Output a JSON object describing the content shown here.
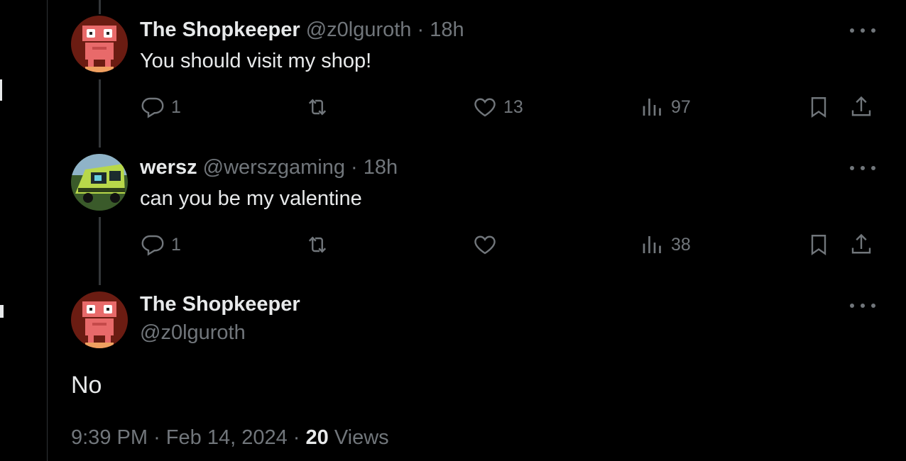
{
  "tweets": [
    {
      "name": "The Shopkeeper",
      "handle": "@z0lguroth",
      "time": "18h",
      "text": "You should visit my shop!",
      "replies": "1",
      "likes": "13",
      "views": "97"
    },
    {
      "name": "wersz",
      "handle": "@werszgaming",
      "time": "18h",
      "text": "can you be my valentine",
      "replies": "1",
      "views": "38"
    }
  ],
  "main": {
    "name": "The Shopkeeper",
    "handle": "@z0lguroth",
    "text": "No",
    "time": "9:39 PM",
    "date": "Feb 14, 2024",
    "views_count": "20",
    "views_label": "Views"
  },
  "separator": "·",
  "icons": {
    "reply": "reply-icon",
    "retweet": "retweet-icon",
    "like": "heart-icon",
    "views": "views-icon",
    "bookmark": "bookmark-icon",
    "share": "share-icon",
    "more": "more-icon"
  },
  "colors": {
    "background": "#000000",
    "text": "#e7e9ea",
    "muted": "#71767b",
    "thread_line": "#333639",
    "shopkeeper_avatar_bg": "#6b1c12",
    "robot": "#e86a6a"
  }
}
